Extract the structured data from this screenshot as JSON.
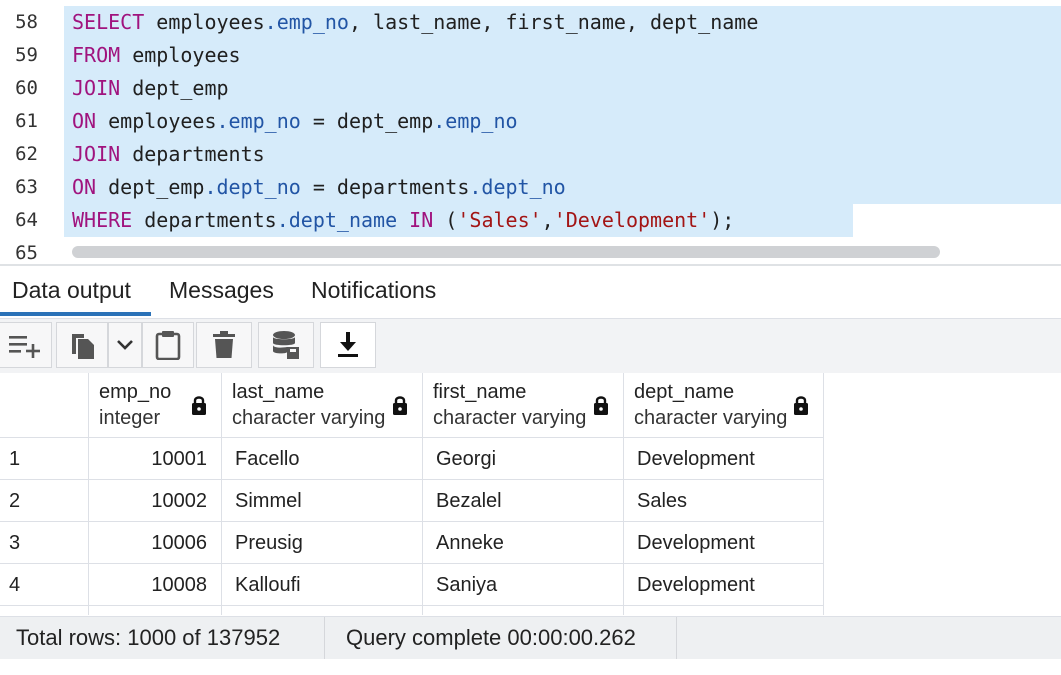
{
  "editor": {
    "lines": [
      {
        "num": "58",
        "tokens": [
          [
            "kw",
            "SELECT"
          ],
          [
            "",
            "employees"
          ],
          [
            "prop",
            ".emp_no"
          ],
          [
            "",
            ", last_name, first_name, dept_name"
          ]
        ]
      },
      {
        "num": "59",
        "tokens": [
          [
            "kw",
            "FROM"
          ],
          [
            "",
            " employees"
          ]
        ]
      },
      {
        "num": "60",
        "tokens": [
          [
            "kw",
            "JOIN"
          ],
          [
            "",
            " dept_emp"
          ]
        ]
      },
      {
        "num": "61",
        "tokens": [
          [
            "kw",
            "ON"
          ],
          [
            "",
            " employees"
          ],
          [
            "prop",
            ".emp_no"
          ],
          [
            "",
            " = dept_emp"
          ],
          [
            "prop",
            ".emp_no"
          ]
        ]
      },
      {
        "num": "62",
        "tokens": [
          [
            "kw",
            "JOIN"
          ],
          [
            "",
            " departments"
          ]
        ]
      },
      {
        "num": "63",
        "tokens": [
          [
            "kw",
            "ON"
          ],
          [
            "",
            " dept_emp"
          ],
          [
            "prop",
            ".dept_no"
          ],
          [
            "",
            " = departments"
          ],
          [
            "prop",
            ".dept_no"
          ]
        ]
      },
      {
        "num": "64",
        "tokens": [
          [
            "kw",
            "WHERE"
          ],
          [
            "",
            " departments"
          ],
          [
            "prop",
            ".dept_name"
          ],
          [
            "kw",
            " IN"
          ],
          [
            "",
            " ("
          ],
          [
            "str",
            "'Sales'"
          ],
          [
            "",
            ","
          ],
          [
            "str",
            "'Development'"
          ],
          [
            "",
            ");"
          ]
        ]
      },
      {
        "num": "65",
        "tokens": []
      }
    ]
  },
  "tabs": {
    "data_output": "Data output",
    "messages": "Messages",
    "notifications": "Notifications"
  },
  "toolbar": {
    "icons": [
      "add-row-icon",
      "copy-icon",
      "chevron-down-icon",
      "paste-icon",
      "delete-icon",
      "save-data-icon",
      "download-icon"
    ]
  },
  "grid": {
    "columns": [
      {
        "name": "emp_no",
        "type": "integer"
      },
      {
        "name": "last_name",
        "type": "character varying"
      },
      {
        "name": "first_name",
        "type": "character varying"
      },
      {
        "name": "dept_name",
        "type": "character varying"
      }
    ],
    "rows": [
      {
        "n": "1",
        "emp_no": "10001",
        "last_name": "Facello",
        "first_name": "Georgi",
        "dept_name": "Development"
      },
      {
        "n": "2",
        "emp_no": "10002",
        "last_name": "Simmel",
        "first_name": "Bezalel",
        "dept_name": "Sales"
      },
      {
        "n": "3",
        "emp_no": "10006",
        "last_name": "Preusig",
        "first_name": "Anneke",
        "dept_name": "Development"
      },
      {
        "n": "4",
        "emp_no": "10008",
        "last_name": "Kalloufi",
        "first_name": "Saniya",
        "dept_name": "Development"
      }
    ]
  },
  "status": {
    "total_rows": "Total rows: 1000 of 137952",
    "query": "Query complete 00:00:00.262"
  },
  "colors": {
    "selection": "#d6ebfa",
    "keyword": "#a0137e",
    "property": "#2255a5",
    "string": "#a31515",
    "active_tab": "#2b72b8"
  }
}
